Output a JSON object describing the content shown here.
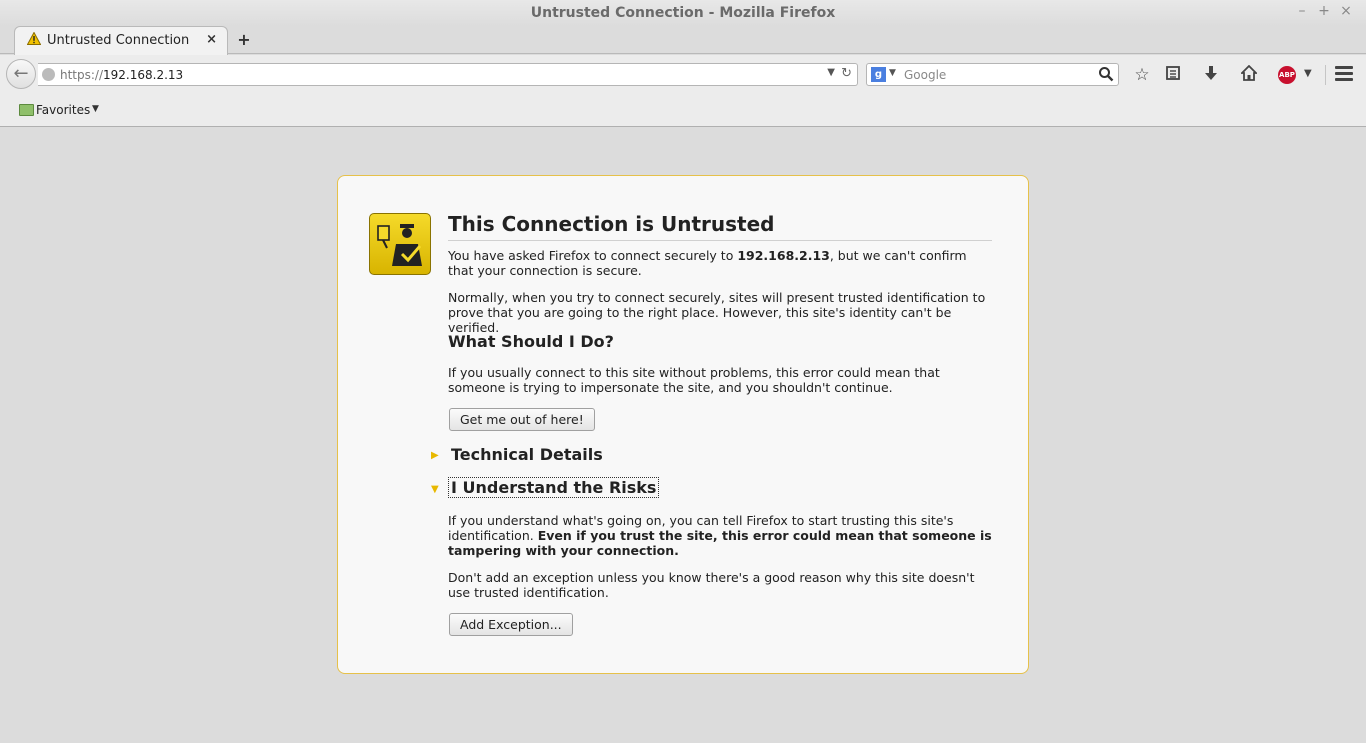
{
  "window": {
    "title": "Untrusted Connection - Mozilla Firefox",
    "controls": {
      "minimize": "–",
      "maximize": "+",
      "close": "×"
    }
  },
  "tabs": [
    {
      "label": "Untrusted Connection",
      "icon": "warning-icon",
      "close": "×"
    }
  ],
  "new_tab_label": "+",
  "navbar": {
    "url_protocol": "https://",
    "url_host": "192.168.2.13",
    "search_placeholder": "Google",
    "search_engine_letter": "g"
  },
  "bookmarks": {
    "items": [
      {
        "label": "Favorites",
        "icon": "folder-icon"
      }
    ]
  },
  "error_page": {
    "title": "This Connection is Untrusted",
    "intro_before": "You have asked Firefox to connect securely to ",
    "intro_host": "192.168.2.13",
    "intro_after": ", but we can't confirm that your connection is secure.",
    "para2": "Normally, when you try to connect securely, sites will present trusted identification to prove that you are going to the right place. However, this site's identity can't be verified.",
    "what_heading": "What Should I Do?",
    "what_text": "If you usually connect to this site without problems, this error could mean that someone is trying to impersonate the site, and you shouldn't continue.",
    "get_out_button": "Get me out of here!",
    "technical_details": "Technical Details",
    "understand_risks": "I Understand the Risks",
    "risks_text_plain": "If you understand what's going on, you can tell Firefox to start trusting this site's identification. ",
    "risks_text_bold": "Even if you trust the site, this error could mean that someone is tampering with your connection.",
    "risks_text2": "Don't add an exception unless you know there's a good reason why this site doesn't use trusted identification.",
    "add_exception_button": "Add Exception..."
  },
  "colors": {
    "accent_yellow": "#e8b800",
    "box_border": "#e6c14a",
    "abp_red": "#c8102e"
  }
}
